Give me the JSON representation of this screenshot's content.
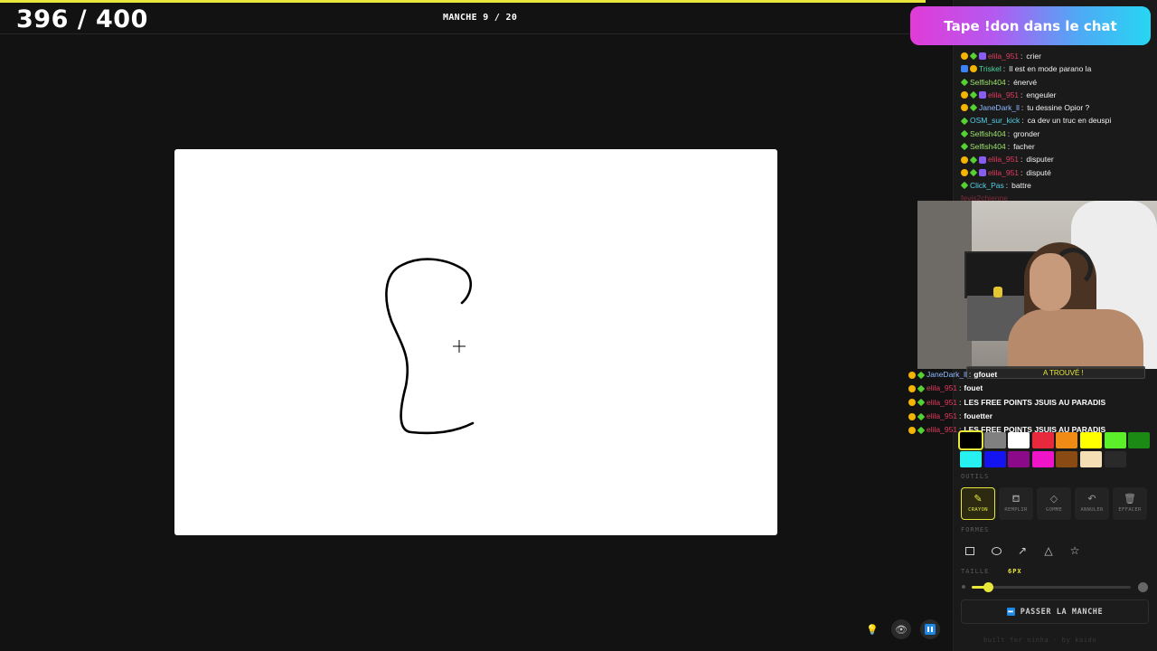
{
  "header": {
    "score": "396 / 400",
    "round": "MANCHE 9 / 20",
    "progress_fraction": 0.8
  },
  "banner": {
    "text": "Tape !don dans le chat"
  },
  "chat": [
    {
      "user": "elila_951",
      "text": "crier",
      "color": "#e23a5e",
      "badges": [
        "orange",
        "green",
        "purple"
      ],
      "faded": false
    },
    {
      "user": "Triskel",
      "text": "Il est en mode parano la",
      "color": "#4ad6a0",
      "badges": [
        "blue",
        "orange"
      ],
      "faded": false
    },
    {
      "user": "Selfish404",
      "text": "énervé",
      "color": "#9be36a",
      "badges": [
        "green"
      ],
      "faded": false
    },
    {
      "user": "elila_951",
      "text": "engeuler",
      "color": "#e23a5e",
      "badges": [
        "orange",
        "green",
        "purple"
      ],
      "faded": false
    },
    {
      "user": "JaneDark_ll",
      "text": "tu dessine Opior ?",
      "color": "#8fb8ff",
      "badges": [
        "orange",
        "green"
      ],
      "faded": false
    },
    {
      "user": "OSM_sur_kick",
      "text": "ca dev un truc en deuspi",
      "color": "#56d0e8",
      "badges": [
        "green"
      ],
      "faded": false
    },
    {
      "user": "Selfish404",
      "text": "gronder",
      "color": "#9be36a",
      "badges": [
        "green"
      ],
      "faded": false
    },
    {
      "user": "Selfish404",
      "text": "facher",
      "color": "#9be36a",
      "badges": [
        "green"
      ],
      "faded": false
    },
    {
      "user": "elila_951",
      "text": "disputer",
      "color": "#e23a5e",
      "badges": [
        "orange",
        "green",
        "purple"
      ],
      "faded": false
    },
    {
      "user": "elila_951",
      "text": "disputé",
      "color": "#e23a5e",
      "badges": [
        "orange",
        "green",
        "purple"
      ],
      "faded": false
    },
    {
      "user": "Click_Pas",
      "text": "battre",
      "color": "#56d0e8",
      "badges": [
        "green"
      ],
      "faded": false
    },
    {
      "user": "fevis2chienne",
      "text": "",
      "color": "#e23a5e",
      "badges": [],
      "faded": true
    }
  ],
  "found_banner": "A TROUVÉ !",
  "overlay_chat": [
    {
      "user": "JaneDark_ll",
      "text": "gfouet",
      "color": "#8fb8ff"
    },
    {
      "user": "elila_951",
      "text": "fouet",
      "color": "#e23a5e"
    },
    {
      "user": "elila_951",
      "text": "LES FREE POINTS JSUIS AU PARADIS",
      "color": "#e23a5e"
    },
    {
      "user": "elila_951",
      "text": "fouetter",
      "color": "#e23a5e"
    },
    {
      "user": "elila_951",
      "text": "LES FREE POINTS JSUIS AU PARADIS",
      "color": "#e23a5e"
    }
  ],
  "palette": {
    "colors": [
      "#000000",
      "#808080",
      "#ffffff",
      "#e8283c",
      "#f08c16",
      "#ffff00",
      "#5cf02a",
      "#1a8a14",
      "#27f0f0",
      "#1414f0",
      "#8a0a8a",
      "#f014c8",
      "#8a4a14",
      "#f5deb3",
      "#2a2a2a"
    ],
    "selected_index": 0
  },
  "labels": {
    "tools_section": "OUTILS",
    "shapes_section": "FORMES",
    "size_section": "TAILLE",
    "size_value": "6PX"
  },
  "tools": [
    {
      "id": "crayon",
      "label": "CRAYON",
      "icon": "pencil-icon",
      "glyph": "✎",
      "active": true
    },
    {
      "id": "remplir",
      "label": "REMPLIR",
      "icon": "paint-bucket-icon",
      "glyph": "⛾",
      "active": false
    },
    {
      "id": "gomme",
      "label": "GOMME",
      "icon": "eraser-icon",
      "glyph": "◇",
      "active": false
    },
    {
      "id": "annuler",
      "label": "ANNULER",
      "icon": "undo-icon",
      "glyph": "↶",
      "active": false
    },
    {
      "id": "effacer",
      "label": "EFFACER",
      "icon": "trash-icon",
      "glyph": "🗑",
      "active": false
    }
  ],
  "shapes": [
    "rectangle-icon",
    "ellipse-icon",
    "arrow-icon",
    "triangle-icon",
    "star-icon"
  ],
  "brush": {
    "size_fraction": 0.1
  },
  "skip_button": "PASSER LA MANCHE",
  "footer": "built for ninha · by kaido"
}
